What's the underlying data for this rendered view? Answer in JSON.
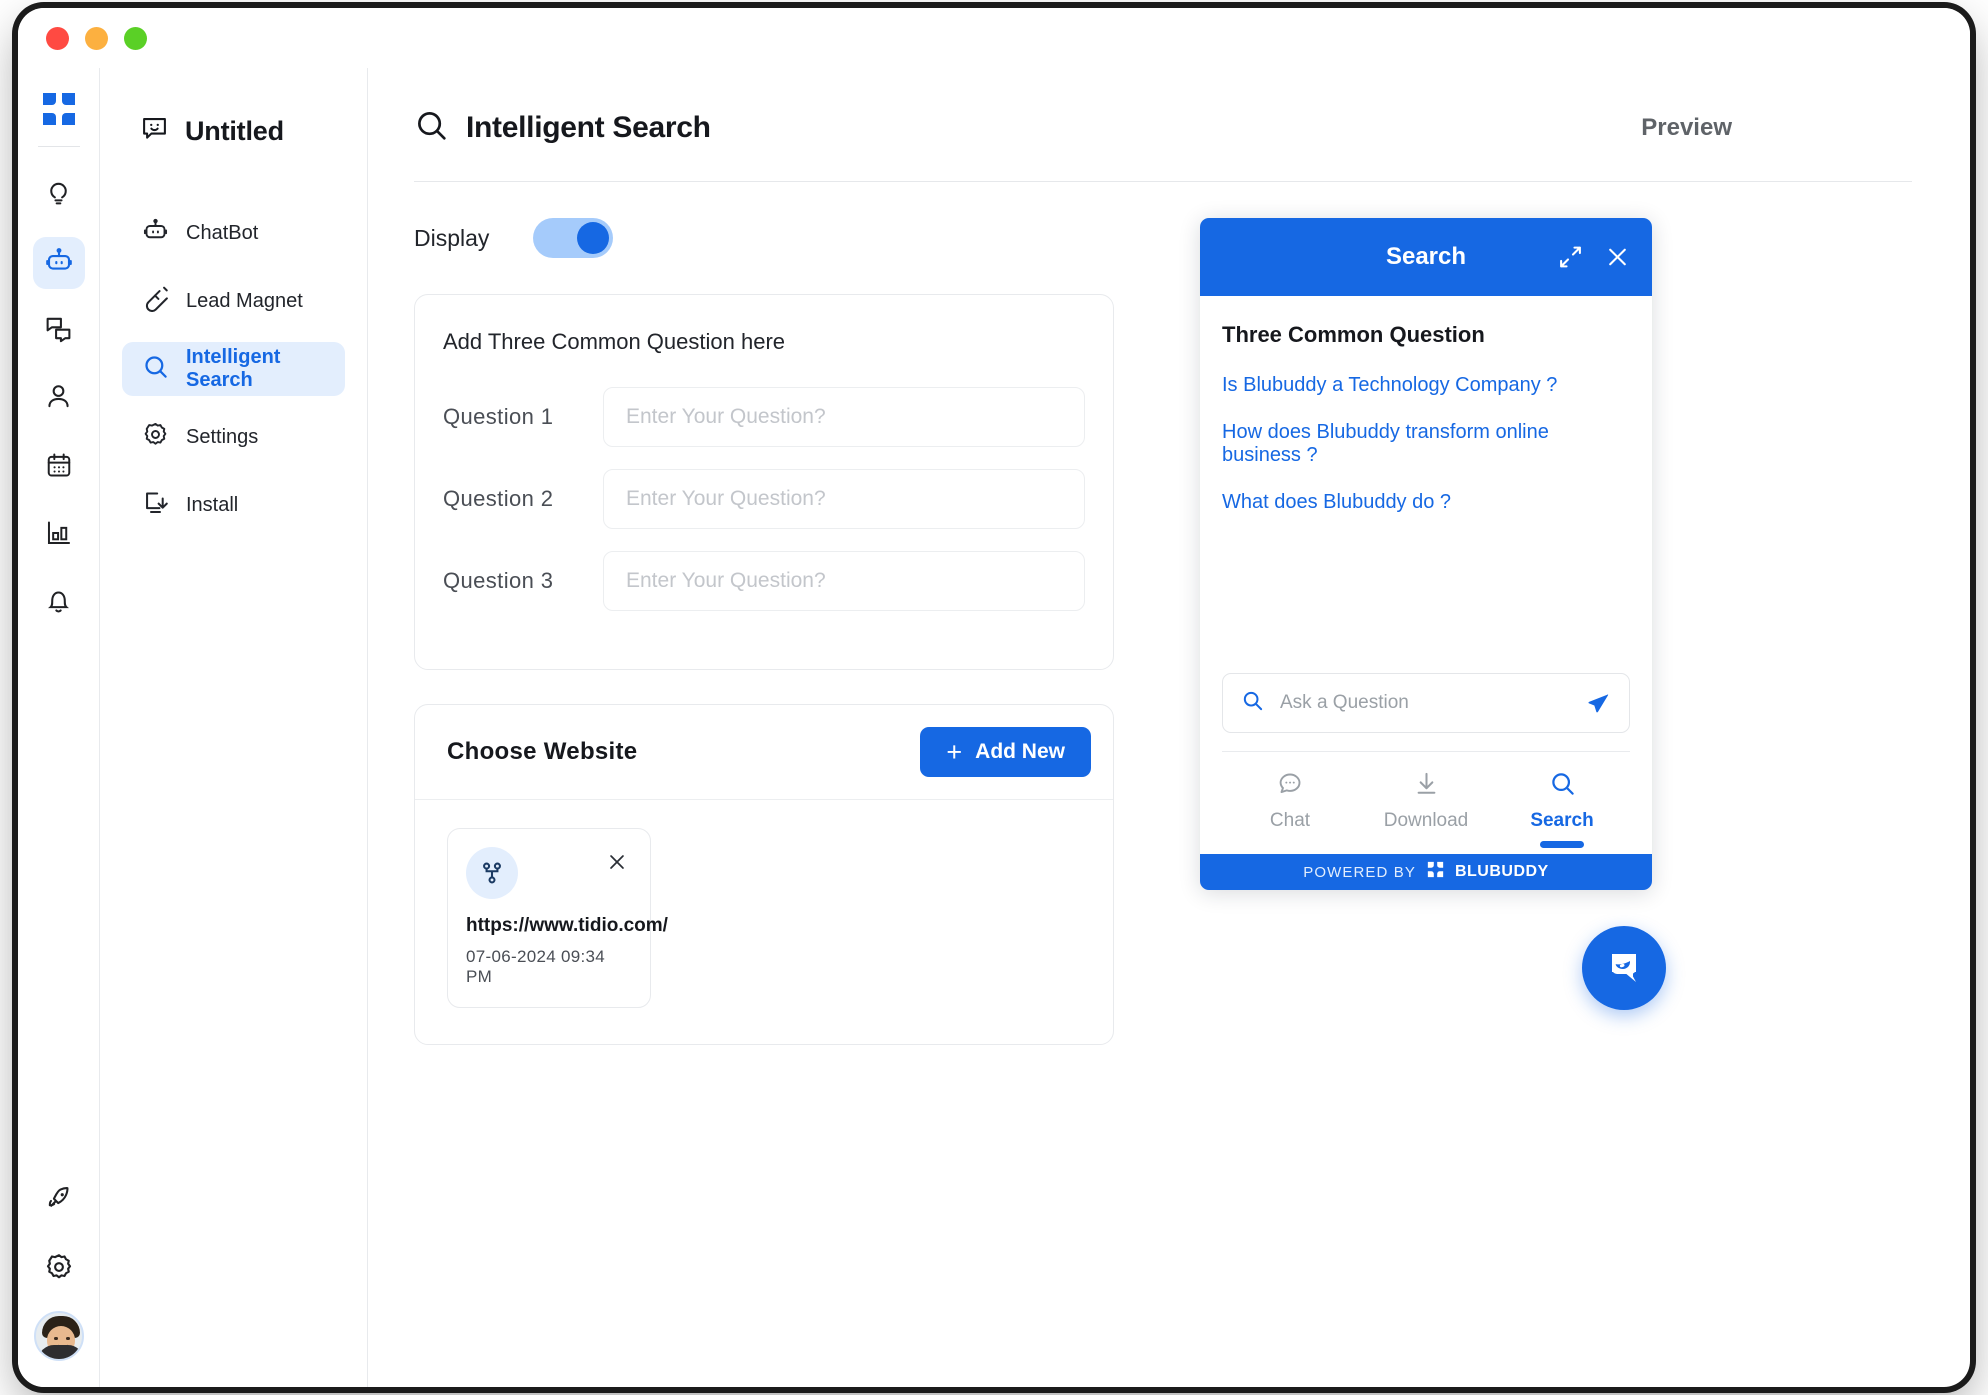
{
  "window": {
    "traffic_lights": [
      "close",
      "minimize",
      "maximize"
    ],
    "colors": {
      "accent": "#1668e3",
      "accent_soft": "#e3eefd",
      "text": "#16181d",
      "muted": "#5f6368"
    }
  },
  "rail": {
    "logo": "blubuddy-logo",
    "items": [
      {
        "name": "insights",
        "icon": "lightbulb-icon",
        "active": false
      },
      {
        "name": "chatbot",
        "icon": "robot-icon",
        "active": true
      },
      {
        "name": "conversations",
        "icon": "chat-bubbles-icon",
        "active": false
      },
      {
        "name": "contacts",
        "icon": "user-icon",
        "active": false
      },
      {
        "name": "calendar",
        "icon": "calendar-icon",
        "active": false
      },
      {
        "name": "analytics",
        "icon": "bar-chart-icon",
        "active": false
      },
      {
        "name": "notifications",
        "icon": "bell-icon",
        "active": false
      }
    ],
    "bottom_items": [
      {
        "name": "upgrade",
        "icon": "rocket-icon"
      },
      {
        "name": "settings",
        "icon": "gear-icon"
      }
    ],
    "avatar": "user-avatar"
  },
  "subnav": {
    "bot_name": "Untitled",
    "bot_icon": "smiley-chat-icon",
    "items": [
      {
        "label": "ChatBot",
        "icon": "robot-icon",
        "active": false
      },
      {
        "label": "Lead Magnet",
        "icon": "magnet-icon",
        "active": false
      },
      {
        "label": "Intelligent Search",
        "icon": "search-icon",
        "active": true
      },
      {
        "label": "Settings",
        "icon": "gear-icon",
        "active": false
      },
      {
        "label": "Install",
        "icon": "install-icon",
        "active": false
      }
    ]
  },
  "main": {
    "title": "Intelligent Search",
    "title_icon": "search-icon",
    "preview_label": "Preview",
    "display": {
      "label": "Display",
      "enabled": true
    },
    "questions_card": {
      "heading": "Add Three Common Question here",
      "rows": [
        {
          "label": "Question  1",
          "value": "",
          "placeholder": "Enter Your Question?"
        },
        {
          "label": "Question  2",
          "value": "",
          "placeholder": "Enter Your Question?"
        },
        {
          "label": "Question  3",
          "value": "",
          "placeholder": "Enter Your Question?"
        }
      ]
    },
    "website_card": {
      "heading": "Choose  Website",
      "add_button": {
        "label": "Add New",
        "icon": "plus-icon"
      },
      "sites": [
        {
          "icon": "sitemap-icon",
          "url": "https://www.tidio.com/",
          "date": "07-06-2024 09:34 PM",
          "remove_icon": "close-icon"
        }
      ]
    }
  },
  "preview": {
    "header": {
      "title": "Search",
      "expand_icon": "expand-icon",
      "close_icon": "close-icon"
    },
    "subheading": "Three Common Question",
    "questions": [
      "Is Blubuddy a Technology Company ?",
      "How does Blubuddy transform online business ?",
      "What does Blubuddy do ?"
    ],
    "search": {
      "icon": "search-icon",
      "placeholder": "Ask a Question",
      "value": "",
      "send_icon": "send-icon"
    },
    "tabs": [
      {
        "label": "Chat",
        "icon": "chat-dots-icon",
        "active": false
      },
      {
        "label": "Download",
        "icon": "download-icon",
        "active": false
      },
      {
        "label": "Search",
        "icon": "search-icon",
        "active": true
      }
    ],
    "footer": {
      "powered_by": "POWERED BY",
      "brand": "BLUBUDDY",
      "logo": "blubuddy-logo"
    },
    "bubble_icon": "chat-leaf-bubble-icon"
  }
}
